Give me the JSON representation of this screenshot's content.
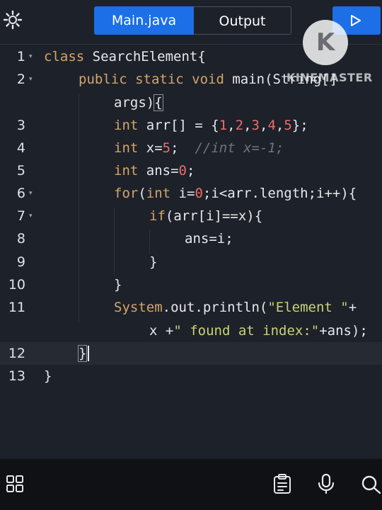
{
  "tabs": [
    {
      "label": "Main.java",
      "active": true
    },
    {
      "label": "Output",
      "active": false
    }
  ],
  "watermark": {
    "logo": "K",
    "text": "KINEMASTER"
  },
  "colors": {
    "accent": "#1c6fe6",
    "background": "#1d2129",
    "keyword": "#d4a56a",
    "number": "#ef6b6b",
    "string": "#c9d27a",
    "comment": "#6f7480"
  },
  "icons": {
    "settings": "gear-icon",
    "run": "play-icon",
    "grid": "grid-icon",
    "clipboard": "clipboard-icon",
    "mic": "mic-icon",
    "search": "search-icon"
  },
  "editor": {
    "lines": [
      {
        "number": "1",
        "fold": true,
        "tokens": [
          [
            "kw",
            "class"
          ],
          [
            "plain",
            " SearchElement{"
          ]
        ]
      },
      {
        "number": "2",
        "fold": true,
        "tokens": [
          [
            "kw",
            "public static void"
          ],
          [
            "plain",
            " main(String[]"
          ]
        ]
      },
      {
        "number": "",
        "fold": false,
        "tokens": [
          [
            "plain",
            "args)"
          ],
          [
            "bracket",
            "{"
          ]
        ]
      },
      {
        "number": "3",
        "fold": false,
        "tokens": [
          [
            "kw",
            "int"
          ],
          [
            "plain",
            " arr[] = {"
          ],
          [
            "num",
            "1"
          ],
          [
            "plain",
            ","
          ],
          [
            "num",
            "2"
          ],
          [
            "plain",
            ","
          ],
          [
            "num",
            "3"
          ],
          [
            "plain",
            ","
          ],
          [
            "num",
            "4"
          ],
          [
            "plain",
            ","
          ],
          [
            "num",
            "5"
          ],
          [
            "plain",
            "};"
          ]
        ]
      },
      {
        "number": "4",
        "fold": false,
        "tokens": [
          [
            "kw",
            "int"
          ],
          [
            "plain",
            " x="
          ],
          [
            "num",
            "5"
          ],
          [
            "plain",
            ";  "
          ],
          [
            "cm",
            "//int x=-1;"
          ]
        ]
      },
      {
        "number": "5",
        "fold": false,
        "tokens": [
          [
            "kw",
            "int"
          ],
          [
            "plain",
            " ans="
          ],
          [
            "num",
            "0"
          ],
          [
            "plain",
            ";"
          ]
        ]
      },
      {
        "number": "6",
        "fold": true,
        "tokens": [
          [
            "kw",
            "for"
          ],
          [
            "plain",
            "("
          ],
          [
            "kw",
            "int"
          ],
          [
            "plain",
            " i="
          ],
          [
            "num",
            "0"
          ],
          [
            "plain",
            ";i<arr.length;i++){"
          ]
        ]
      },
      {
        "number": "7",
        "fold": true,
        "tokens": [
          [
            "kw",
            "if"
          ],
          [
            "plain",
            "(arr[i]==x){"
          ]
        ]
      },
      {
        "number": "8",
        "fold": false,
        "tokens": [
          [
            "plain",
            "ans=i;"
          ]
        ]
      },
      {
        "number": "9",
        "fold": false,
        "tokens": [
          [
            "plain",
            "}"
          ]
        ]
      },
      {
        "number": "10",
        "fold": false,
        "tokens": [
          [
            "plain",
            "}"
          ]
        ]
      },
      {
        "number": "11",
        "fold": false,
        "tokens": [
          [
            "kw",
            "System"
          ],
          [
            "plain",
            ".out.println("
          ],
          [
            "str",
            "\"Element \""
          ],
          [
            "plain",
            "+"
          ]
        ]
      },
      {
        "number": "",
        "fold": false,
        "tokens": [
          [
            "plain",
            "x +"
          ],
          [
            "str",
            "\" found at index:\""
          ],
          [
            "plain",
            "+ans);"
          ]
        ]
      },
      {
        "number": "12",
        "fold": false,
        "tokens": [
          [
            "bracket",
            "}"
          ]
        ]
      },
      {
        "number": "13",
        "fold": false,
        "tokens": [
          [
            "plain",
            "}"
          ]
        ]
      }
    ]
  }
}
